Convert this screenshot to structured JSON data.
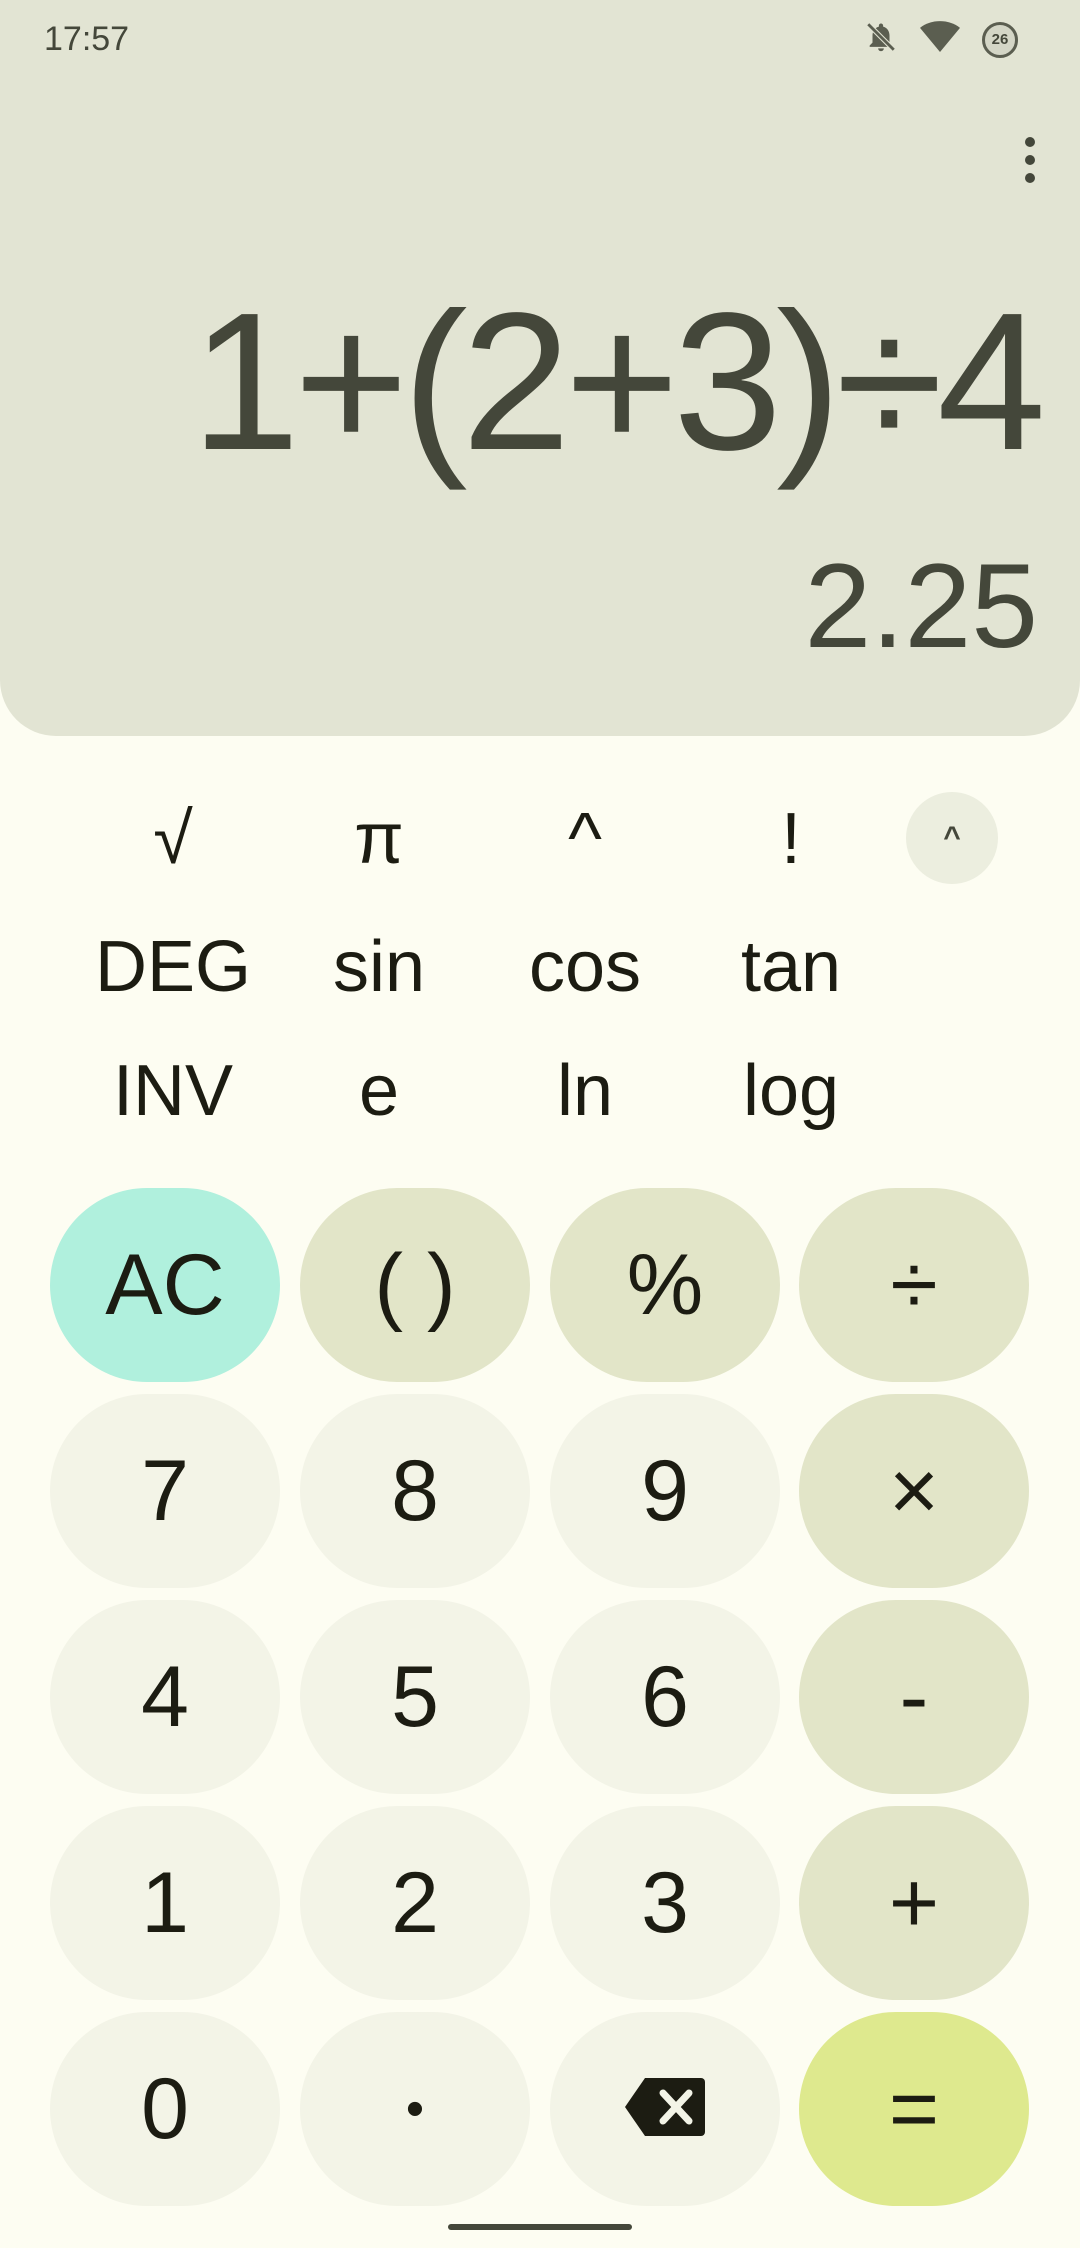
{
  "status_bar": {
    "time": "17:57",
    "battery_level": "26",
    "icons": [
      "notifications-off-icon",
      "wifi-icon",
      "battery-icon"
    ]
  },
  "display": {
    "expression": "1+(2+3)÷4",
    "result": "2.25"
  },
  "scientific": {
    "row1": [
      "√",
      "π",
      "^",
      "!"
    ],
    "row2": [
      "DEG",
      "sin",
      "cos",
      "tan"
    ],
    "row3": [
      "INV",
      "e",
      "ln",
      "log"
    ],
    "collapse_icon": "^"
  },
  "keypad": {
    "clear": "AC",
    "parentheses": "( )",
    "percent": "%",
    "divide": "÷",
    "seven": "7",
    "eight": "8",
    "nine": "9",
    "multiply": "×",
    "four": "4",
    "five": "5",
    "six": "6",
    "minus": "-",
    "one": "1",
    "two": "2",
    "three": "3",
    "plus": "+",
    "zero": "0",
    "decimal": "•",
    "equals": "="
  },
  "colors": {
    "display_bg": "#e2e4d3",
    "page_bg": "#fdfdf2",
    "number_key": "#f3f4e7",
    "operator_key": "#e2e5c8",
    "clear_key": "#b0f0dd",
    "equals_key": "#dee98e"
  }
}
